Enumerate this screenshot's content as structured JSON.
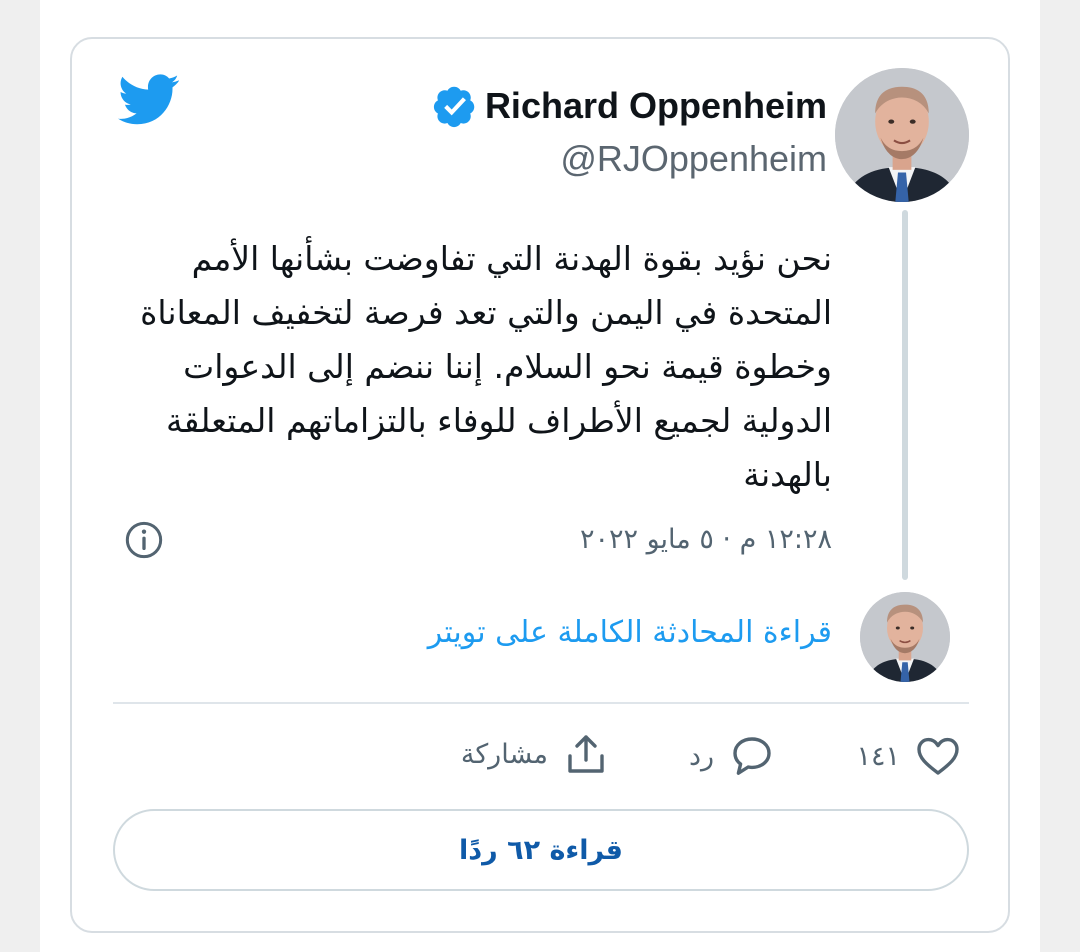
{
  "tweet": {
    "author_name": "Richard Oppenheim",
    "author_handle": "@RJOppenheim",
    "text": "نحن نؤيد بقوة الهدنة التي تفاوضت بشأنها الأمم\nالمتحدة في اليمن والتي تعد فرصة لتخفيف المعاناة\nوخطوة قيمة نحو السلام. إننا ننضم إلى الدعوات\nالدولية لجميع الأطراف للوفاء بالتزاماتهم المتعلقة\nبالهدنة",
    "timestamp": "١٢:٢٨ م · ٥ مايو ٢٠٢٢",
    "read_full_conversation": "قراءة المحادثة الكاملة على تويتر",
    "like_count": "١٤١",
    "reply_label": "رد",
    "share_label": "مشاركة",
    "read_replies_label": "قراءة ٦٢ ردًا"
  },
  "icons": {
    "brand": "twitter-logo-icon",
    "verified": "verified-badge-icon",
    "info": "info-icon",
    "like": "heart-icon",
    "reply": "speech-bubble-icon",
    "share": "share-upload-icon"
  },
  "colors": {
    "twitter_blue": "#1d9bf0",
    "text_primary": "#0f1419",
    "text_secondary": "#536471",
    "border": "#cfd9de",
    "button_text": "#0f5aa8"
  }
}
